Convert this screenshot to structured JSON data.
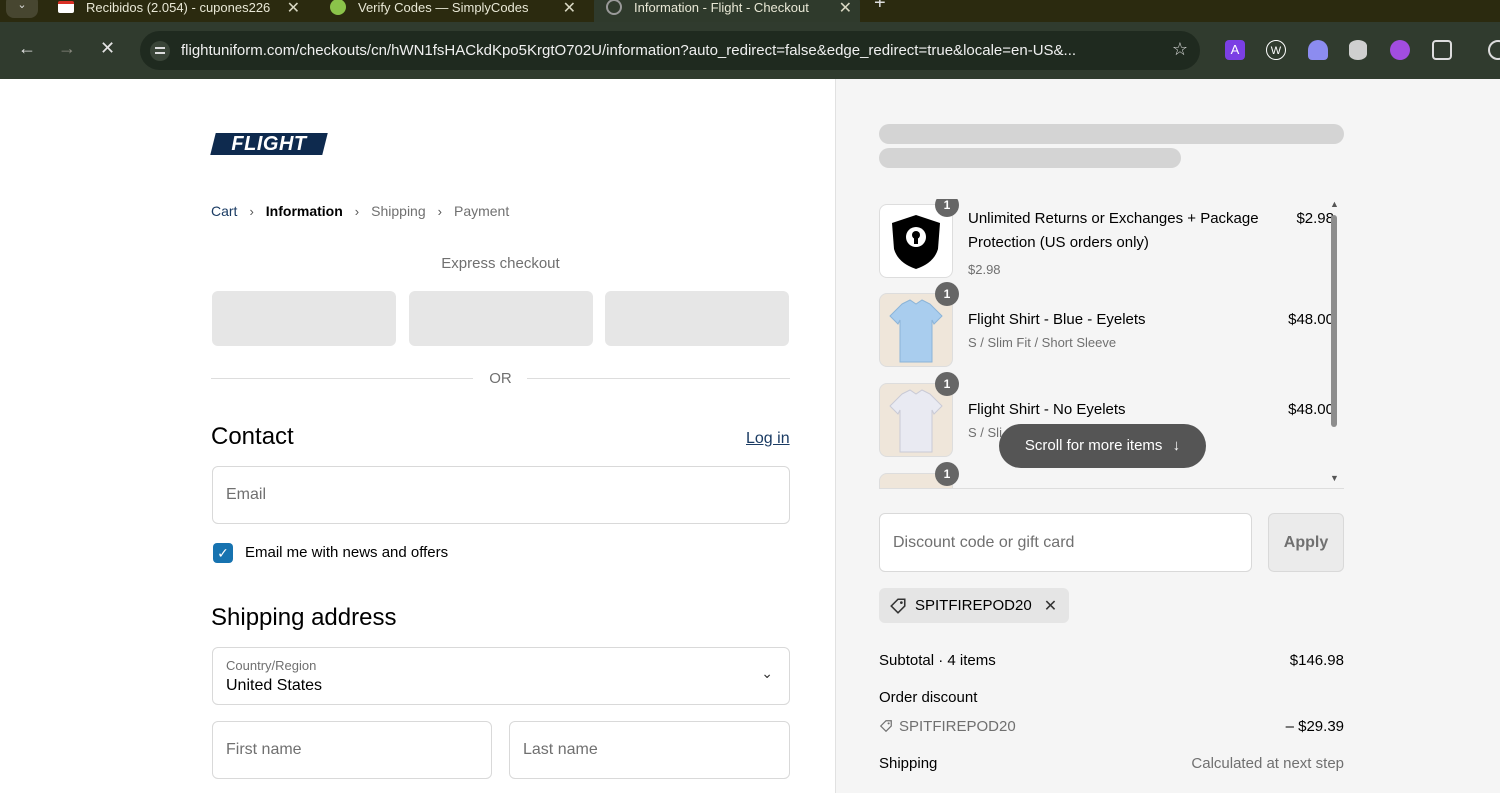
{
  "browser": {
    "tabs": [
      {
        "title": "Recibidos (2.054) - cupones226",
        "icon": "gmail-icon"
      },
      {
        "title": "Verify Codes — SimplyCodes",
        "icon": "simplycodes-icon"
      },
      {
        "title": "Information - Flight - Checkout",
        "icon": "loading-icon"
      }
    ],
    "new_tab": "+",
    "url": "flightuniform.com/checkouts/cn/hWN1fsHACkdKpo5KrgtO702U/information?auto_redirect=false&edge_redirect=true&locale=en-US&...",
    "extensions": [
      "A",
      "W",
      "",
      "",
      "",
      ""
    ]
  },
  "brand": {
    "logo_text": "FLIGHT",
    "color": "#0e2a4e"
  },
  "breadcrumb": {
    "items": [
      "Cart",
      "Information",
      "Shipping",
      "Payment"
    ],
    "current": "Information"
  },
  "express": {
    "label": "Express checkout",
    "or": "OR"
  },
  "contact": {
    "title": "Contact",
    "login": "Log in",
    "email_placeholder": "Email",
    "newsletter_label": "Email me with news and offers",
    "newsletter_checked": true
  },
  "shipping": {
    "title": "Shipping address",
    "country_label": "Country/Region",
    "country_value": "United States",
    "first_name_placeholder": "First name",
    "last_name_placeholder": "Last name"
  },
  "cart": {
    "items": [
      {
        "name": "Unlimited Returns or Exchanges + Package Protection (US orders only)",
        "sub": "$2.98",
        "price": "$2.98",
        "qty": "1"
      },
      {
        "name": "Flight Shirt - Blue - Eyelets",
        "sub": "S / Slim Fit / Short Sleeve",
        "price": "$48.00",
        "qty": "1"
      },
      {
        "name": "Flight Shirt - No Eyelets",
        "sub": "S / Sli",
        "price": "$48.00",
        "qty": "1"
      },
      {
        "name": "",
        "sub": "",
        "price": "",
        "qty": "1"
      }
    ],
    "scroll_hint": "Scroll for more items",
    "discount_placeholder": "Discount code or gift card",
    "apply_label": "Apply",
    "applied_code": "SPITFIREPOD20"
  },
  "summary": {
    "subtotal_label": "Subtotal · 4 items",
    "subtotal_value": "$146.98",
    "discount_label": "Order discount",
    "discount_code": "SPITFIREPOD20",
    "discount_value": "– $29.39",
    "shipping_label": "Shipping",
    "shipping_value": "Calculated at next step"
  },
  "colors": {
    "accent": "#1773b0",
    "link": "#1a3b63",
    "sidebar_bg": "#f5f5f5"
  }
}
